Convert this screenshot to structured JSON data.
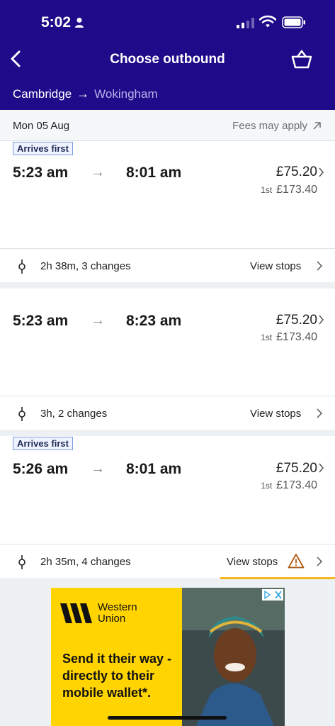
{
  "status_bar": {
    "time": "5:02"
  },
  "header": {
    "title": "Choose outbound",
    "origin": "Cambridge",
    "route_arrow": "→",
    "destination": "Wokingham"
  },
  "date_bar": {
    "date": "Mon 05 Aug",
    "fees": "Fees may apply"
  },
  "journeys": [
    {
      "badge": "Arrives first",
      "depart": "5:23 am",
      "arrow": "→",
      "arrive": "8:01 am",
      "price": "£75.20",
      "first_class_label": "1st",
      "first_class_price": "£173.40",
      "duration": "2h 38m, 3 changes",
      "view_stops": "View stops",
      "warning": false
    },
    {
      "badge": "",
      "depart": "5:23 am",
      "arrow": "→",
      "arrive": "8:23 am",
      "price": "£75.20",
      "first_class_label": "1st",
      "first_class_price": "£173.40",
      "duration": "3h, 2 changes",
      "view_stops": "View stops",
      "warning": false
    },
    {
      "badge": "Arrives first",
      "depart": "5:26 am",
      "arrow": "→",
      "arrive": "8:01 am",
      "price": "£75.20",
      "first_class_label": "1st",
      "first_class_price": "£173.40",
      "duration": "2h 35m, 4 changes",
      "view_stops": "View stops",
      "warning": true
    }
  ],
  "ad": {
    "brand_line1": "Western",
    "brand_line2": "Union",
    "headline": "Send it their way - directly to their mobile wallet*.",
    "brand_color": "#ffd400"
  },
  "colors": {
    "header_bg": "#1f0a8a",
    "warning": "#b05a12",
    "highlight": "#f3b81f"
  }
}
